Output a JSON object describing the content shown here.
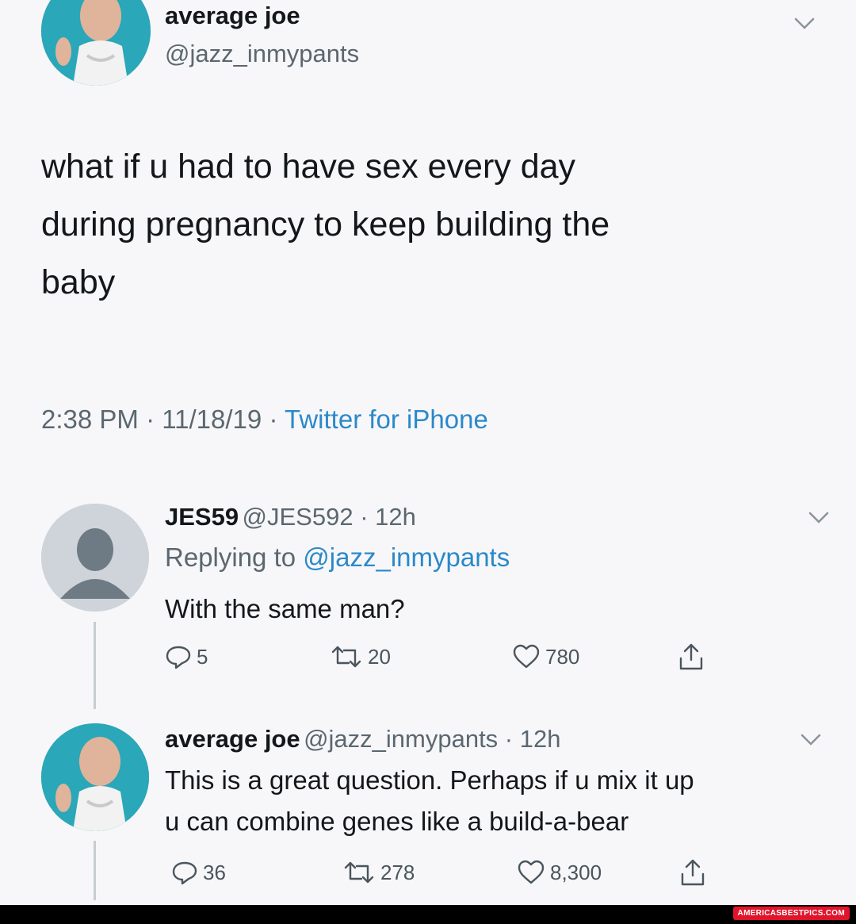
{
  "main_tweet": {
    "name": "average joe",
    "handle": "@jazz_inmypants",
    "text_lines": [
      "what if u had to have sex every day",
      "during pregnancy to keep building the",
      "baby"
    ],
    "time": "2:38 PM",
    "date": "11/18/19",
    "separator": "·",
    "source": "Twitter for iPhone"
  },
  "reply1": {
    "name": "JES59",
    "handle_time": "@JES592 · 12h",
    "replying_prefix": "Replying to",
    "replying_handle": "@jazz_inmypants",
    "text": "With the same man?",
    "replies": "5",
    "retweets": "20",
    "likes": "780"
  },
  "reply2": {
    "name": "average joe",
    "handle_time": "@jazz_inmypants · 12h",
    "text_lines": [
      "This is a great question. Perhaps if u mix it up",
      "u can combine genes like a build-a-bear"
    ],
    "replies": "36",
    "retweets": "278",
    "likes": "8,300"
  },
  "watermark": "AMERICASBESTPICS.COM",
  "colors": {
    "link": "#2b89c9",
    "avatar_teal": "#2aa7b8",
    "secondary_text": "#5b6770"
  },
  "icons": [
    "chevron-down-icon",
    "reply-icon",
    "retweet-icon",
    "like-icon",
    "share-icon"
  ]
}
